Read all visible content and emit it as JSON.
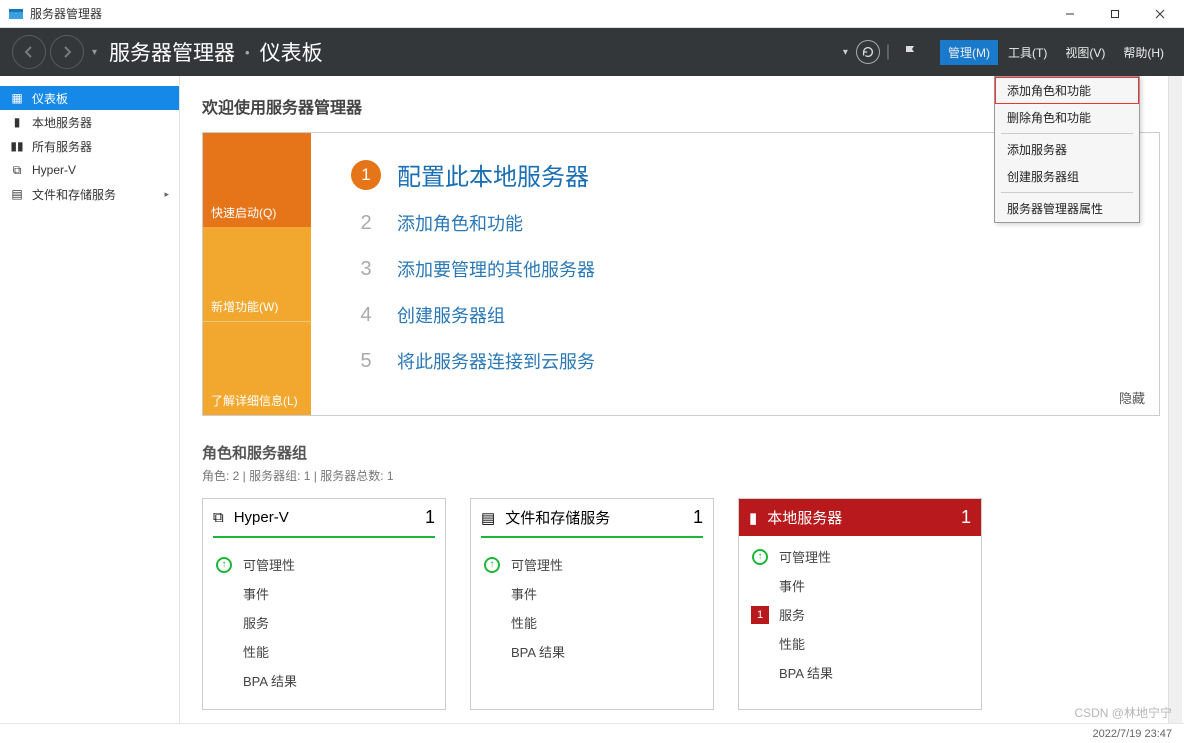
{
  "app": {
    "title": "服务器管理器"
  },
  "header": {
    "crumb_root": "服务器管理器",
    "crumb_page": "仪表板",
    "menu": {
      "manage": "管理(M)",
      "tools": "工具(T)",
      "view": "视图(V)",
      "help": "帮助(H)"
    }
  },
  "sidebar": {
    "items": [
      {
        "icon": "dashboard",
        "label": "仪表板",
        "active": true
      },
      {
        "icon": "server",
        "label": "本地服务器"
      },
      {
        "icon": "servers",
        "label": "所有服务器"
      },
      {
        "icon": "hyperv",
        "label": "Hyper-V"
      },
      {
        "icon": "storage",
        "label": "文件和存储服务",
        "expandable": true
      }
    ]
  },
  "welcome": {
    "title": "欢迎使用服务器管理器",
    "side_tabs": {
      "quick": "快速启动(Q)",
      "whatsnew": "新增功能(W)",
      "learn": "了解详细信息(L)"
    },
    "steps": [
      {
        "n": "1",
        "label": "配置此本地服务器",
        "primary": true
      },
      {
        "n": "2",
        "label": "添加角色和功能"
      },
      {
        "n": "3",
        "label": "添加要管理的其他服务器"
      },
      {
        "n": "4",
        "label": "创建服务器组"
      },
      {
        "n": "5",
        "label": "将此服务器连接到云服务"
      }
    ],
    "hide": "隐藏"
  },
  "roles": {
    "title": "角色和服务器组",
    "subtitle": "角色: 2 | 服务器组: 1 | 服务器总数: 1",
    "row_labels": {
      "manage": "可管理性",
      "events": "事件",
      "services": "服务",
      "perf": "性能",
      "bpa": "BPA 结果"
    },
    "tiles": [
      {
        "name": "Hyper-V",
        "count": "1",
        "type": "role"
      },
      {
        "name": "文件和存储服务",
        "count": "1",
        "type": "role"
      },
      {
        "name": "本地服务器",
        "count": "1",
        "type": "local",
        "services_alert": "1"
      }
    ]
  },
  "dropdown": {
    "items": [
      {
        "label": "添加角色和功能",
        "highlight": true
      },
      {
        "label": "删除角色和功能"
      },
      {
        "sep": true
      },
      {
        "label": "添加服务器"
      },
      {
        "label": "创建服务器组"
      },
      {
        "sep": true
      },
      {
        "label": "服务器管理器属性"
      }
    ]
  },
  "statusbar": {
    "datetime": "2022/7/19 23:47"
  },
  "watermark": "CSDN @林地宁宁"
}
